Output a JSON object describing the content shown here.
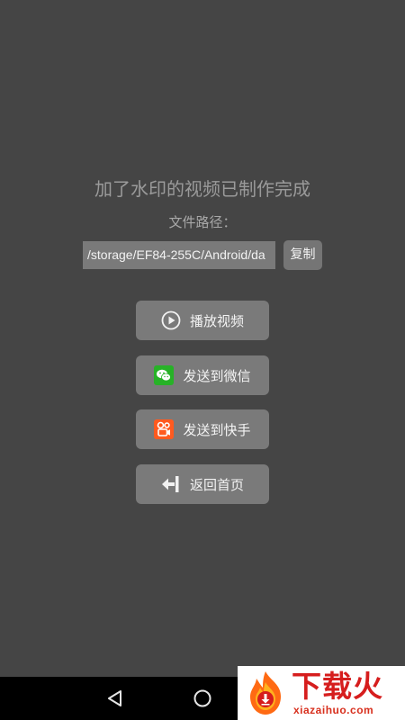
{
  "main": {
    "title": "加了水印的视频已制作完成",
    "path_label": "文件路径：",
    "path_value": "/storage/EF84-255C/Android/da",
    "copy_label": "复制"
  },
  "actions": {
    "play": {
      "label": "播放视频",
      "icon": "play-circle-icon"
    },
    "wechat": {
      "label": "发送到微信",
      "icon": "wechat-icon"
    },
    "kuaishou": {
      "label": "发送到快手",
      "icon": "kuaishou-icon"
    },
    "home": {
      "label": "返回首页",
      "icon": "exit-arrow-icon"
    }
  },
  "navbar": {
    "back_icon": "back-triangle-icon",
    "home_icon": "home-circle-icon",
    "recent_icon": "recent-square-icon"
  },
  "watermark": {
    "text": "下载火",
    "subtext": "xiazaihuo.com"
  },
  "colors": {
    "background": "#454545",
    "button": "#7a7a7a",
    "wechat_green": "#27b227",
    "kuaishou_orange": "#ff5a1f",
    "watermark_red": "#d61d1d"
  }
}
